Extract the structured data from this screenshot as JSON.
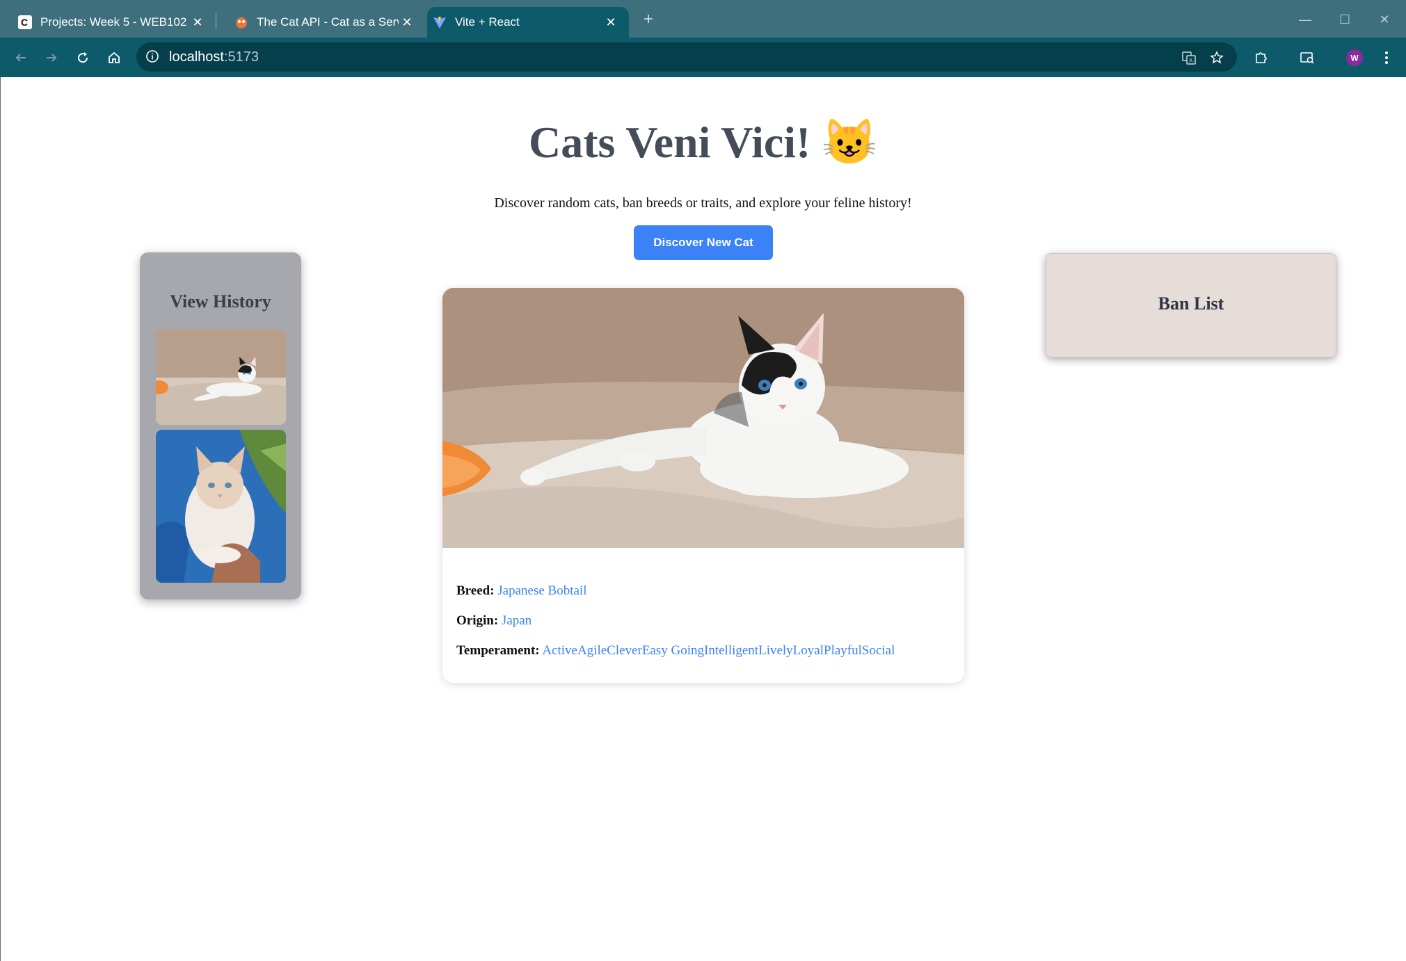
{
  "browser": {
    "tabs": [
      {
        "title": "Projects: Week 5 - WEB102 | ",
        "icon": "codepath-icon",
        "active": false
      },
      {
        "title": "The Cat API - Cat as a Service",
        "icon": "cat-api-icon",
        "active": false
      },
      {
        "title": "Vite + React",
        "icon": "vite-icon",
        "active": true
      }
    ],
    "url_host": "localhost",
    "url_port": ":5173",
    "profile_initial": "W",
    "colors": {
      "frame": "#3e6f7c",
      "toolbar": "#0d5a6b",
      "omnibox": "#063f4c"
    }
  },
  "page": {
    "title": "Cats Veni Vici! 😺",
    "subtitle": "Discover random cats, ban breeds or traits, and explore your feline history!",
    "discover_button": "Discover New Cat",
    "history": {
      "title": "View History",
      "items": [
        "black-white-kitten-on-couch",
        "cream-cat-held-in-arms"
      ]
    },
    "ban_list": {
      "title": "Ban List"
    },
    "cat": {
      "image": "black-white-kitten-on-couch",
      "breed_label": "Breed:",
      "breed": "Japanese Bobtail",
      "origin_label": "Origin:",
      "origin": "Japan",
      "temperament_label": "Temperament:",
      "temperament": "ActiveAgileCleverEasy GoingIntelligentLivelyLoyalPlayfulSocial"
    },
    "colors": {
      "accent": "#3b82f6",
      "history_bg": "#a6a8ad",
      "ban_bg": "#e6ddd8",
      "title": "#454c59"
    }
  }
}
